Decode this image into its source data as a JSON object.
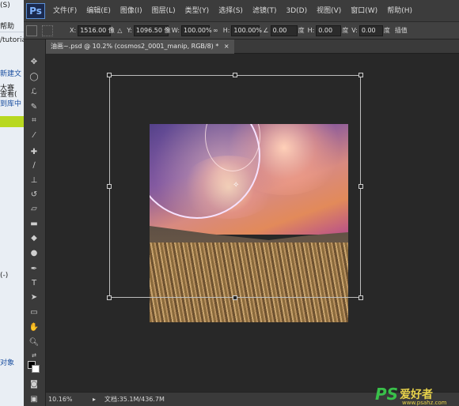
{
  "background_window": {
    "lines": [
      "(S)",
      "帮助",
      "/tutoria",
      "新建文",
      "大赛",
      "查看(",
      "到库中"
    ],
    "lower": [
      "(-)",
      "对象"
    ]
  },
  "menu": {
    "logo": "Ps",
    "items": [
      "文件(F)",
      "编辑(E)",
      "图像(I)",
      "图层(L)",
      "类型(Y)",
      "选择(S)",
      "滤镜(T)",
      "3D(D)",
      "视图(V)",
      "窗口(W)",
      "帮助(H)"
    ]
  },
  "options": {
    "x_label": "X:",
    "x_value": "1516.00 像",
    "y_label": "Y:",
    "y_value": "1096.50 像",
    "w_label": "W:",
    "w_value": "100.00%",
    "h_label": "H:",
    "h_value": "100.00%",
    "angle_value": "0.00",
    "angle_unit": "度",
    "hskew_label": "H:",
    "hskew_value": "0.00",
    "hskew_unit": "度",
    "vskew_label": "V:",
    "vskew_value": "0.00",
    "vskew_unit": "度",
    "interp": "插值"
  },
  "tab": {
    "title": "油画~.psd @ 10.2% (cosmos2_0001_manip, RGB/8) *",
    "close": "×"
  },
  "status": {
    "zoom": "10.16%",
    "doc": "文档:35.1M/436.7M",
    "arrow": "▸"
  },
  "watermark": {
    "logo": "PS",
    "name": "爱好者",
    "url": "www.psahz.com"
  },
  "colors": {
    "menu_bg": "#3c3c3c",
    "workspace_bg": "#282828",
    "ps_blue": "#7fb4ff"
  }
}
